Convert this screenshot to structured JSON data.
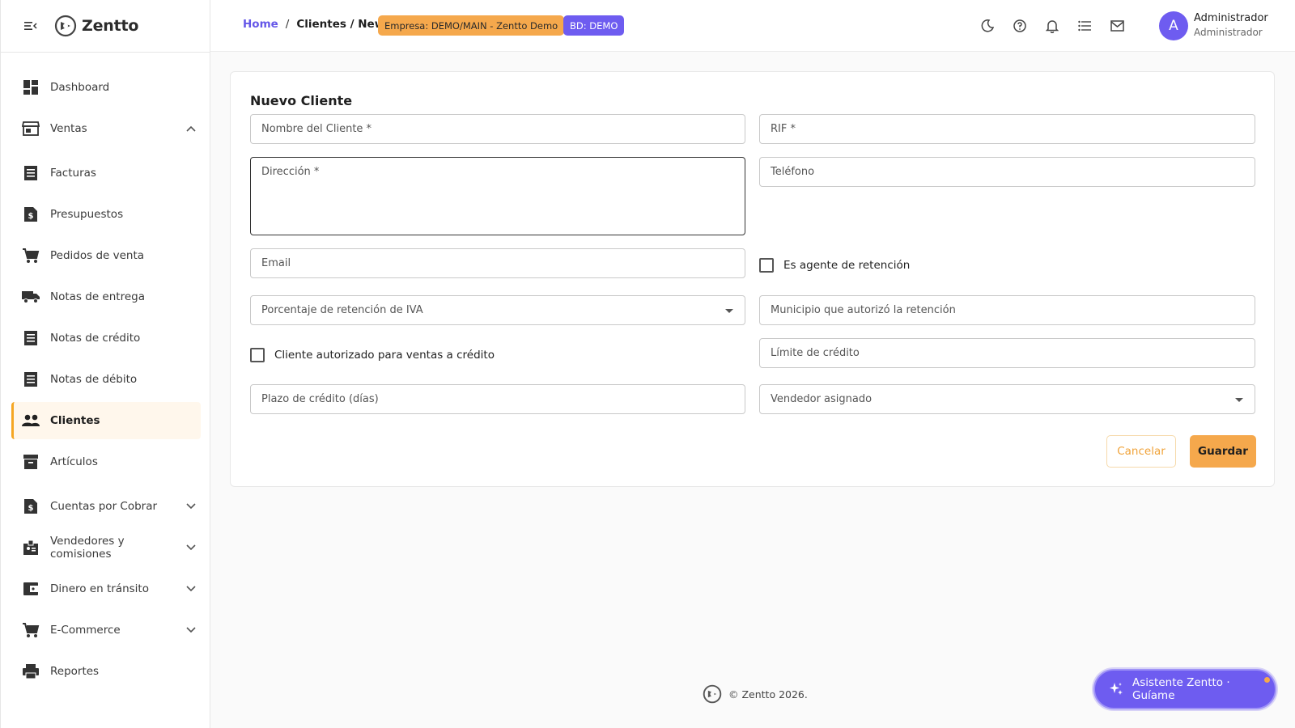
{
  "app": {
    "name": "Zentto"
  },
  "sidebar": {
    "items": [
      {
        "label": "Dashboard",
        "icon": "dashboard-icon",
        "expandable": false,
        "active": false
      },
      {
        "label": "Ventas",
        "icon": "store-icon",
        "expandable": true,
        "expanded": true,
        "active": false
      },
      {
        "label": "Facturas",
        "icon": "receipt-icon",
        "expandable": false,
        "active": false
      },
      {
        "label": "Presupuestos",
        "icon": "request-quote-icon",
        "expandable": false,
        "active": false
      },
      {
        "label": "Pedidos de venta",
        "icon": "cart-icon",
        "expandable": false,
        "active": false
      },
      {
        "label": "Notas de entrega",
        "icon": "truck-icon",
        "expandable": false,
        "active": false
      },
      {
        "label": "Notas de crédito",
        "icon": "receipt-icon",
        "expandable": false,
        "active": false
      },
      {
        "label": "Notas de débito",
        "icon": "receipt-icon",
        "expandable": false,
        "active": false
      },
      {
        "label": "Clientes",
        "icon": "people-icon",
        "expandable": false,
        "active": true
      },
      {
        "label": "Artículos",
        "icon": "inventory-icon",
        "expandable": false,
        "active": false
      },
      {
        "label": "Cuentas por Cobrar",
        "icon": "request-quote-icon",
        "expandable": true,
        "expanded": false,
        "active": false
      },
      {
        "label": "Vendedores y comisiones",
        "icon": "badge-icon",
        "expandable": true,
        "expanded": false,
        "active": false
      },
      {
        "label": "Dinero en tránsito",
        "icon": "wallet-icon",
        "expandable": true,
        "expanded": false,
        "active": false
      },
      {
        "label": "E-Commerce",
        "icon": "cart-icon",
        "expandable": true,
        "expanded": false,
        "active": false
      },
      {
        "label": "Reportes",
        "icon": "printer-icon",
        "expandable": false,
        "active": false
      }
    ]
  },
  "topbar": {
    "breadcrumb": {
      "home": "Home",
      "separator": "/",
      "current": "Clientes / New"
    },
    "badge_empresa": "Empresa: DEMO/MAIN - Zentto Demo",
    "badge_bd": "BD: DEMO",
    "icons": [
      "moon-icon",
      "help-icon",
      "bell-icon",
      "list-icon",
      "mail-icon"
    ],
    "user": {
      "initial": "A",
      "name": "Administrador",
      "role": "Administrador"
    }
  },
  "form": {
    "title": "Nuevo Cliente",
    "fields": {
      "nombre": {
        "placeholder": "Nombre del Cliente *",
        "value": ""
      },
      "rif": {
        "placeholder": "RIF *",
        "value": ""
      },
      "direccion": {
        "placeholder": "Dirección *",
        "value": ""
      },
      "telefono": {
        "placeholder": "Teléfono",
        "value": ""
      },
      "email": {
        "placeholder": "Email",
        "value": ""
      },
      "agente_retencion": {
        "label": "Es agente de retención",
        "checked": false
      },
      "porcentaje_iva": {
        "placeholder": "Porcentaje de retención de IVA",
        "value": ""
      },
      "municipio": {
        "placeholder": "Municipio que autorizó la retención",
        "value": ""
      },
      "credito_autorizado": {
        "label": "Cliente autorizado para ventas a crédito",
        "checked": false
      },
      "limite_credito": {
        "placeholder": "Límite de crédito",
        "value": ""
      },
      "plazo_credito": {
        "placeholder": "Plazo de crédito (días)",
        "value": ""
      },
      "vendedor": {
        "placeholder": "Vendedor asignado",
        "value": ""
      }
    },
    "buttons": {
      "cancel": "Cancelar",
      "save": "Guardar"
    }
  },
  "footer": {
    "text": "© Zentto 2026."
  },
  "assistant": {
    "label": "Asistente Zentto · Guíame"
  },
  "colors": {
    "accent": "#f5a84c",
    "brand_purple": "#6e5cf0",
    "active_bg": "#fff7ec"
  }
}
